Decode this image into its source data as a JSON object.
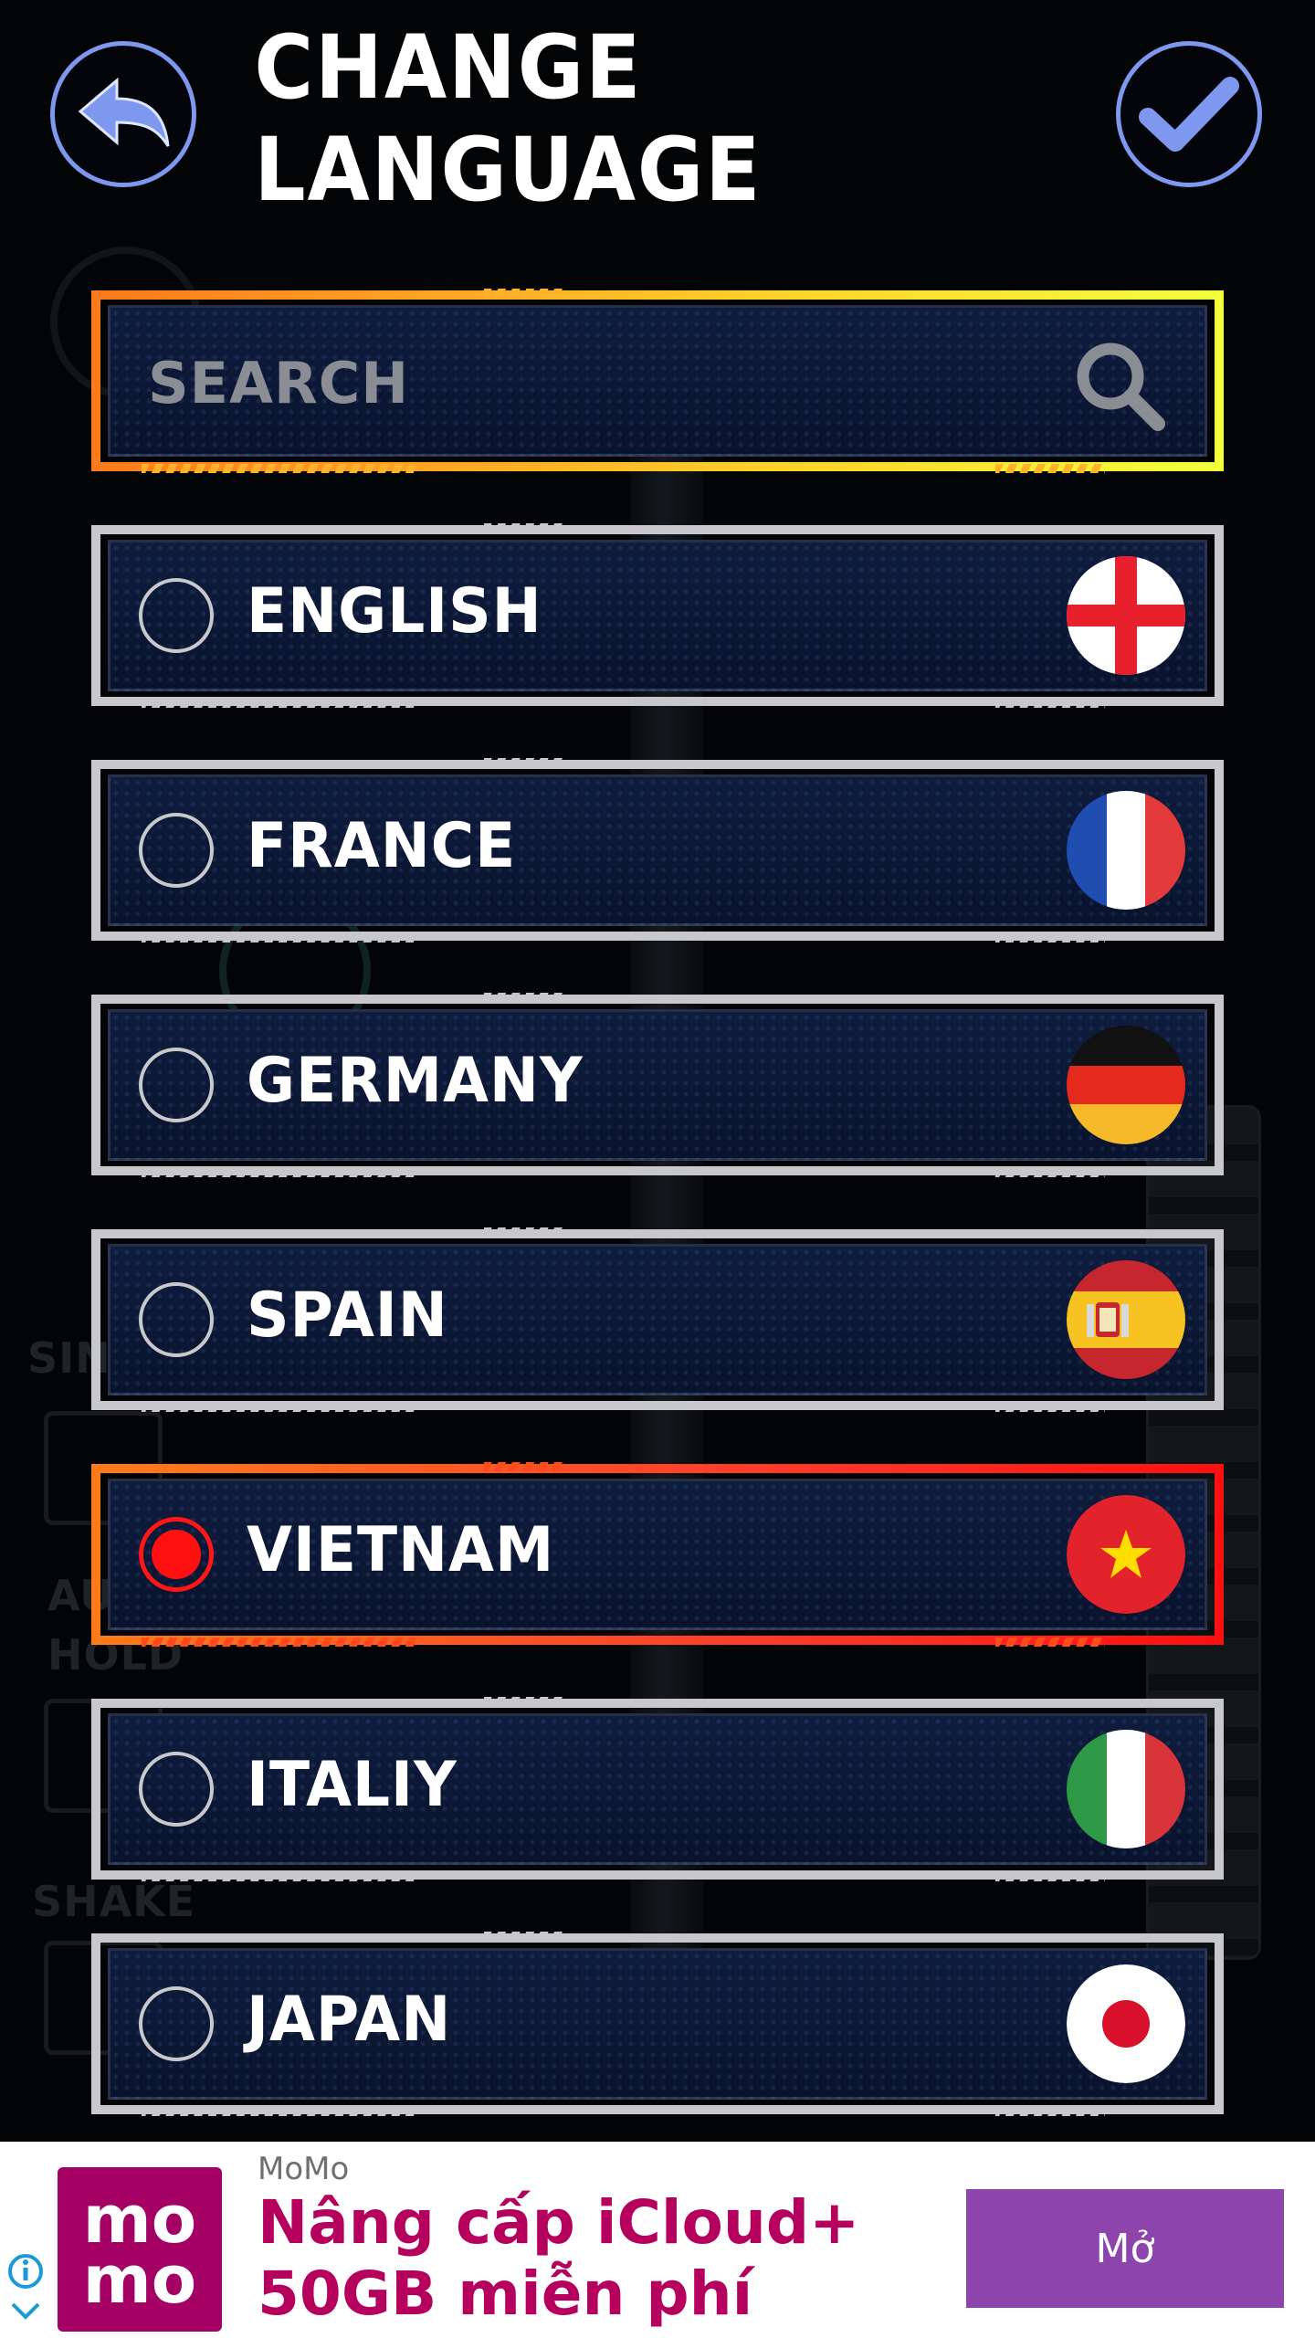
{
  "header": {
    "title": "CHANGE LANGUAGE",
    "back_icon": "back-arrow-icon",
    "confirm_icon": "checkmark-icon"
  },
  "search": {
    "placeholder": "SEARCH",
    "icon": "search-icon"
  },
  "languages": [
    {
      "label": "ENGLISH",
      "flag": "england",
      "selected": false
    },
    {
      "label": "FRANCE",
      "flag": "france",
      "selected": false
    },
    {
      "label": "GERMANY",
      "flag": "germany",
      "selected": false
    },
    {
      "label": "SPAIN",
      "flag": "spain",
      "selected": false
    },
    {
      "label": "VIETNAM",
      "flag": "vietnam",
      "selected": true
    },
    {
      "label": "ITALIY",
      "flag": "italy",
      "selected": false
    },
    {
      "label": "JAPAN",
      "flag": "japan",
      "selected": false
    }
  ],
  "background_labels": {
    "single": "SIN",
    "auto_hold_1": "AU",
    "auto_hold_2": "HOLD",
    "shake": "SHAKE"
  },
  "ad": {
    "source": "MoMo",
    "headline": "Nâng cấp iCloud+ 50GB miễn phí",
    "cta": "Mở",
    "logo_line1": "mo",
    "logo_line2": "mo"
  },
  "colors": {
    "accent_blue": "#7e98f0",
    "selected_red": "#ff1010",
    "plate_navy": "#0b1735",
    "momo_brand": "#a50064",
    "cta_purple": "#8e44ad"
  }
}
